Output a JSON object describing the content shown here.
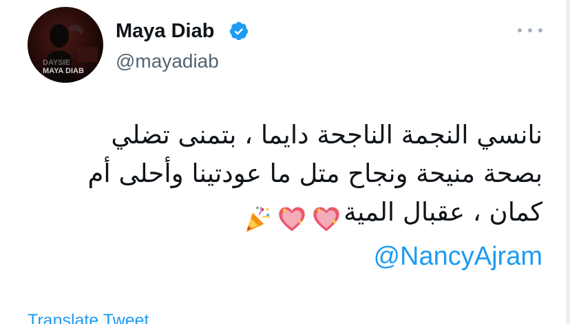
{
  "author": {
    "display_name": "Maya Diab",
    "handle": "@mayadiab",
    "verified": true,
    "avatar_caption": "MAYA DIAB"
  },
  "tweet": {
    "lines": [
      "نانسي النجمة الناجحة دايما ، بتمنى تضلي",
      "بصحة منيحة ونجاح متل ما عودتينا وأحلى أم",
      "كمان ، عقبال المية"
    ],
    "emojis": [
      "party-popper-icon",
      "sparkling-heart-icon",
      "sparkling-heart-icon"
    ],
    "mention": "@NancyAjram"
  },
  "actions": {
    "translate_label": "Translate Tweet"
  },
  "colors": {
    "link_blue": "#1d9bf0",
    "secondary_text": "#536471",
    "primary_text": "#0f1419",
    "verified_blue": "#1d9bf0"
  }
}
